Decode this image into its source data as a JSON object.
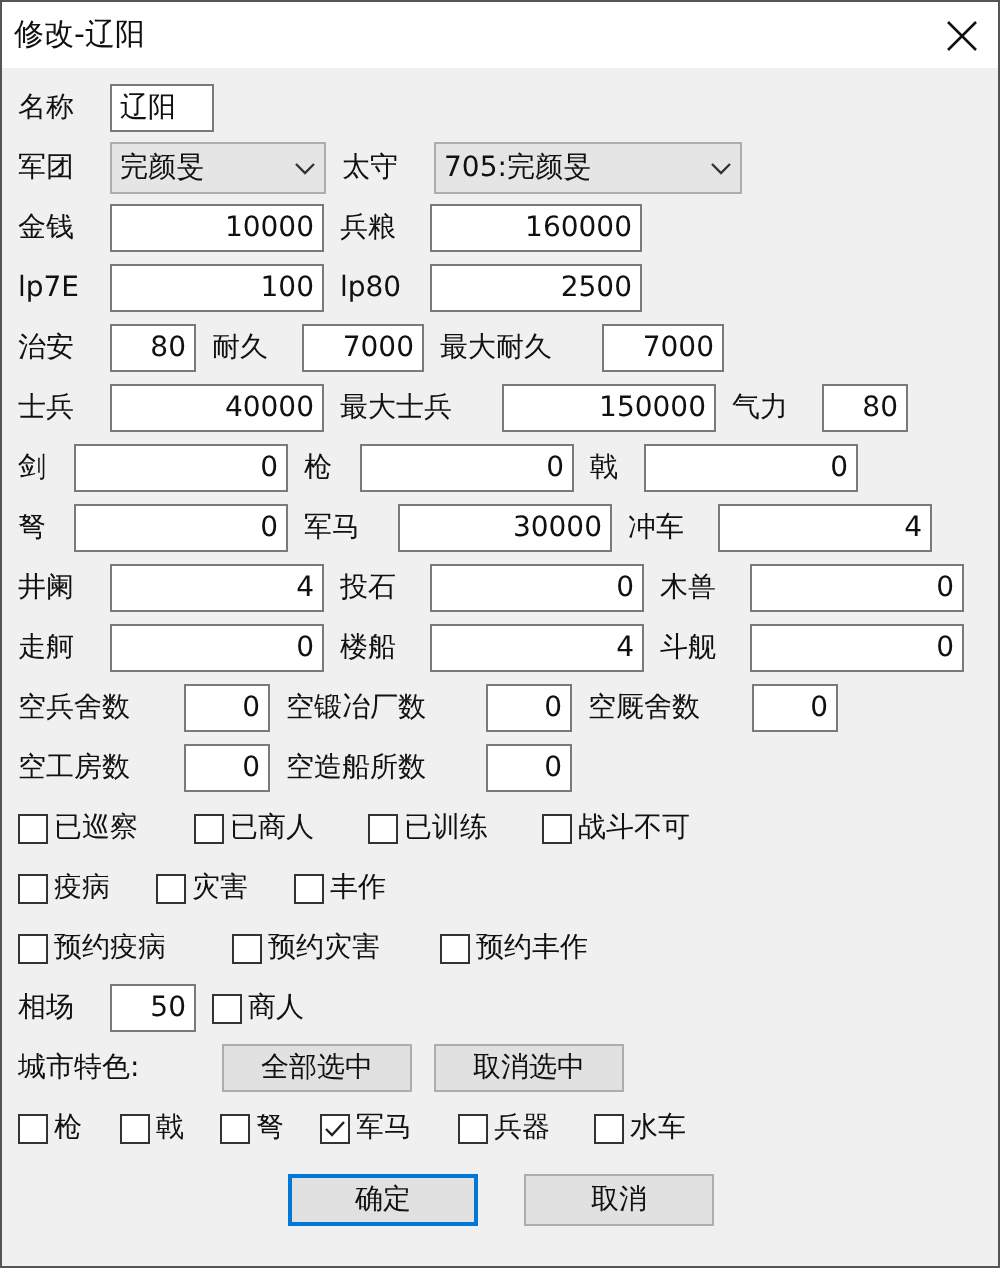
{
  "window": {
    "title": "修改-辽阳"
  },
  "rows": [
    {
      "fields": [
        {
          "label": "名称",
          "value": "辽阳",
          "kind": "text"
        }
      ]
    },
    {
      "fields": [
        {
          "label": "军团",
          "value": "完颜旻",
          "kind": "select"
        },
        {
          "label": "太守",
          "value": "705:完颜旻",
          "kind": "select"
        }
      ]
    },
    {
      "fields": [
        {
          "label": "金钱",
          "value": "10000",
          "kind": "number"
        },
        {
          "label": "兵粮",
          "value": "160000",
          "kind": "number"
        }
      ]
    },
    {
      "fields": [
        {
          "label": "lp7E",
          "value": "100",
          "kind": "number"
        },
        {
          "label": "lp80",
          "value": "2500",
          "kind": "number"
        }
      ]
    },
    {
      "fields": [
        {
          "label": "治安",
          "value": "80",
          "kind": "number"
        },
        {
          "label": "耐久",
          "value": "7000",
          "kind": "number"
        },
        {
          "label": "最大耐久",
          "value": "7000",
          "kind": "number"
        }
      ]
    },
    {
      "fields": [
        {
          "label": "士兵",
          "value": "40000",
          "kind": "number"
        },
        {
          "label": "最大士兵",
          "value": "150000",
          "kind": "number"
        },
        {
          "label": "气力",
          "value": "80",
          "kind": "number"
        }
      ]
    },
    {
      "fields": [
        {
          "label": "剑",
          "value": "0",
          "kind": "number"
        },
        {
          "label": "枪",
          "value": "0",
          "kind": "number"
        },
        {
          "label": "戟",
          "value": "0",
          "kind": "number"
        }
      ]
    },
    {
      "fields": [
        {
          "label": "弩",
          "value": "0",
          "kind": "number"
        },
        {
          "label": "军马",
          "value": "30000",
          "kind": "number"
        },
        {
          "label": "冲车",
          "value": "4",
          "kind": "number"
        }
      ]
    },
    {
      "fields": [
        {
          "label": "井阑",
          "value": "4",
          "kind": "number"
        },
        {
          "label": "投石",
          "value": "0",
          "kind": "number"
        },
        {
          "label": "木兽",
          "value": "0",
          "kind": "number"
        }
      ]
    },
    {
      "fields": [
        {
          "label": "走舸",
          "value": "0",
          "kind": "number"
        },
        {
          "label": "楼船",
          "value": "4",
          "kind": "number"
        },
        {
          "label": "斗舰",
          "value": "0",
          "kind": "number"
        }
      ]
    },
    {
      "fields": [
        {
          "label": "空兵舍数",
          "value": "0",
          "kind": "number"
        },
        {
          "label": "空锻冶厂数",
          "value": "0",
          "kind": "number"
        },
        {
          "label": "空厩舍数",
          "value": "0",
          "kind": "number"
        }
      ]
    },
    {
      "fields": [
        {
          "label": "空工房数",
          "value": "0",
          "kind": "number"
        },
        {
          "label": "空造船所数",
          "value": "0",
          "kind": "number"
        }
      ]
    }
  ],
  "flag_rows": [
    {
      "items": [
        {
          "label": "已巡察",
          "checked": false
        },
        {
          "label": "已商人",
          "checked": false
        },
        {
          "label": "已训练",
          "checked": false
        },
        {
          "label": "战斗不可",
          "checked": false
        }
      ]
    },
    {
      "items": [
        {
          "label": "疫病",
          "checked": false
        },
        {
          "label": "灾害",
          "checked": false
        },
        {
          "label": "丰作",
          "checked": false
        }
      ]
    },
    {
      "items": [
        {
          "label": "预约疫病",
          "checked": false
        },
        {
          "label": "预约灾害",
          "checked": false
        },
        {
          "label": "预约丰作",
          "checked": false
        }
      ]
    }
  ],
  "market": {
    "label": "相场",
    "value": "50",
    "merchant": {
      "label": "商人",
      "checked": false
    }
  },
  "specialty": {
    "label": "城市特色:",
    "buttons": [
      "全部选中",
      "取消选中"
    ],
    "items": [
      {
        "label": "枪",
        "checked": false
      },
      {
        "label": "戟",
        "checked": false
      },
      {
        "label": "弩",
        "checked": false
      },
      {
        "label": "军马",
        "checked": true
      },
      {
        "label": "兵器",
        "checked": false
      },
      {
        "label": "水车",
        "checked": false
      }
    ]
  },
  "buttons": [
    {
      "label": "确定",
      "default": true
    },
    {
      "label": "取消",
      "default": false
    }
  ]
}
